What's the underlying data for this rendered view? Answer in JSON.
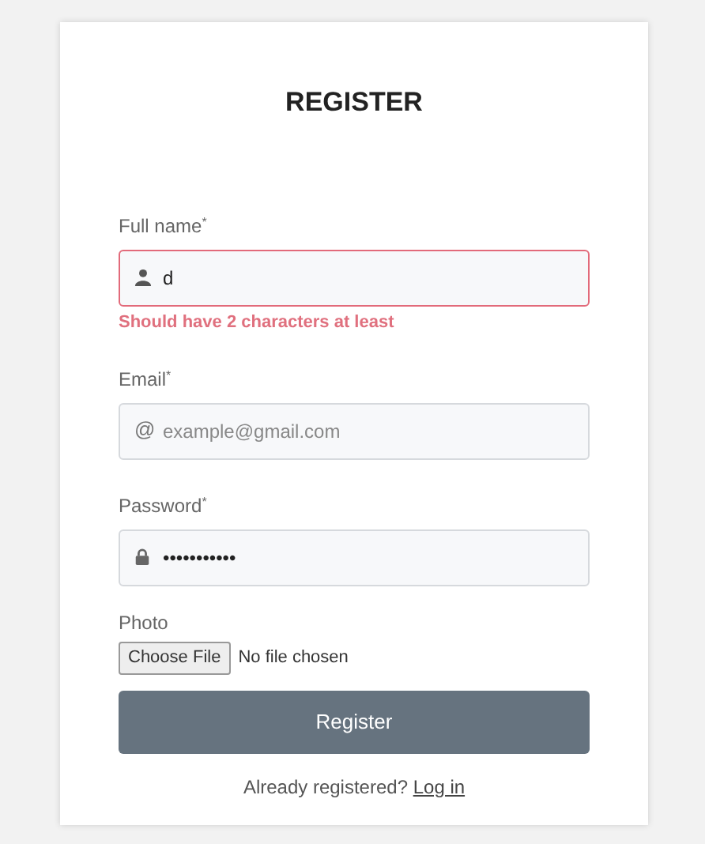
{
  "title": "REGISTER",
  "fields": [
    {
      "kind": "name",
      "label": "Full name",
      "required_mark": "*",
      "value": "d",
      "invalid": true,
      "error": "Should have 2 characters at least"
    },
    {
      "kind": "email",
      "label": "Email",
      "required_mark": "*",
      "icon_char": "@",
      "placeholder": "example@gmail.com",
      "invalid": false
    },
    {
      "kind": "password",
      "label": "Password",
      "required_mark": "*",
      "value": "•••••••••••",
      "invalid": false
    },
    {
      "kind": "file",
      "label": "Photo",
      "button": "Choose File",
      "status": "No file chosen"
    }
  ],
  "submit": "Register",
  "footer": {
    "text": "Already registered?",
    "link": "Log in"
  }
}
